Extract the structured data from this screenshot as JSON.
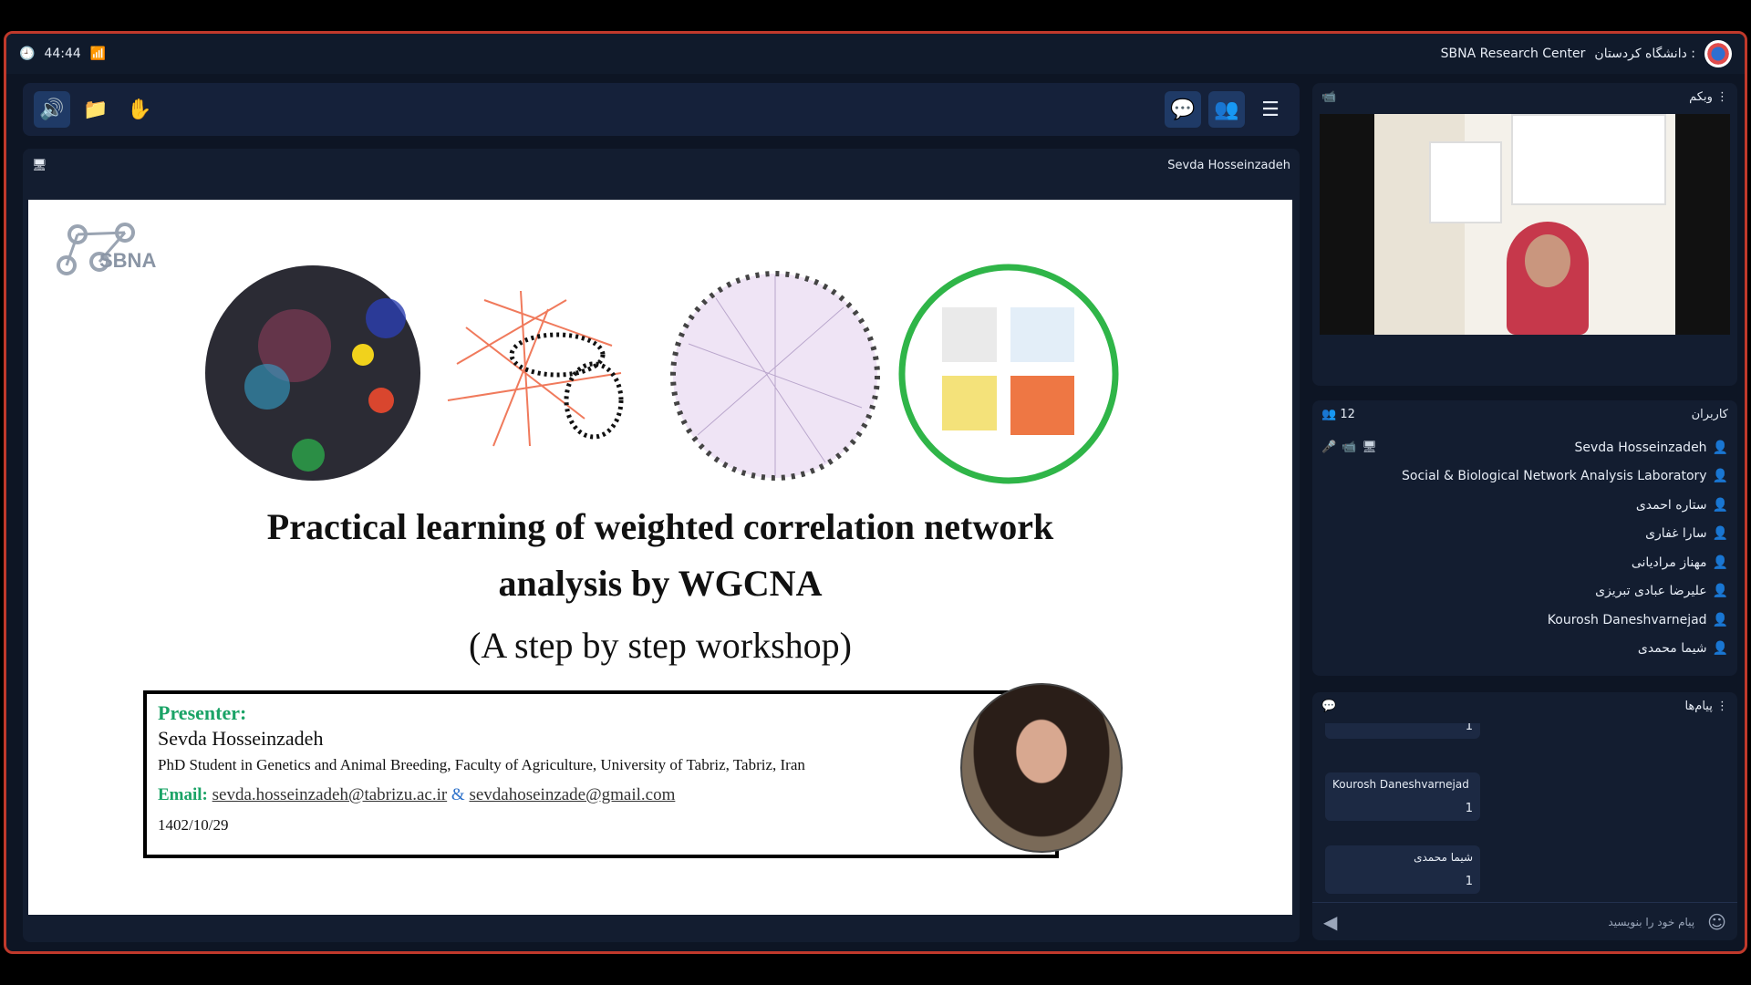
{
  "topbar": {
    "timer": "44:44",
    "org": "دانشگاه کردستان :",
    "center": "SBNA Research Center"
  },
  "toolbar": {
    "icons": [
      "speaker-icon",
      "folder-icon",
      "raise-hand-icon",
      "chat-toggle-icon",
      "users-toggle-icon",
      "menu-icon"
    ]
  },
  "presenter": {
    "name": "Sevda Hosseinzadeh"
  },
  "slide": {
    "logo_text": "SBNA",
    "title_line1": "Practical learning of weighted correlation network",
    "title_line2": "analysis by WGCNA",
    "subtitle": "(A step by step workshop)",
    "presenter_label": "Presenter:",
    "presenter_name": "Sevda Hosseinzadeh",
    "presenter_role": "PhD Student in Genetics and Animal Breeding, Faculty of Agriculture, University of Tabriz, Tabriz, Iran",
    "email_label": "Email:",
    "email1": "sevda.hosseinzadeh@tabrizu.ac.ir",
    "amp": "&",
    "email2": "sevdahoseinzade@gmail.com",
    "date": "1402/10/29"
  },
  "webcam": {
    "title": "وبکم"
  },
  "users": {
    "title": "کاربران",
    "count": "12",
    "list": [
      {
        "name": "Sevda Hosseinzadeh",
        "color": "#3aa3ff"
      },
      {
        "name": "Social & Biological Network Analysis Laboratory",
        "color": "#3aa3ff"
      },
      {
        "name": "ستاره احمدی",
        "color": "#f5a623"
      },
      {
        "name": "سارا غفاری",
        "color": "#f5a623"
      },
      {
        "name": "مهناز مرادیانی",
        "color": "#f5a623"
      },
      {
        "name": "علیرضا عبادی تبریزی",
        "color": "#f5a623"
      },
      {
        "name": "Kourosh Daneshvarnejad",
        "color": "#f5a623"
      },
      {
        "name": "شیما محمدی",
        "color": "#f5a623"
      }
    ]
  },
  "chat": {
    "title": "پیام‌ها",
    "messages": [
      {
        "name": "Kourosh Daneshvarnejad",
        "count": "1"
      },
      {
        "name": "شیما محمدی",
        "count": "1"
      }
    ],
    "first_count": "1",
    "input_placeholder": "پیام خود را بنویسید"
  }
}
